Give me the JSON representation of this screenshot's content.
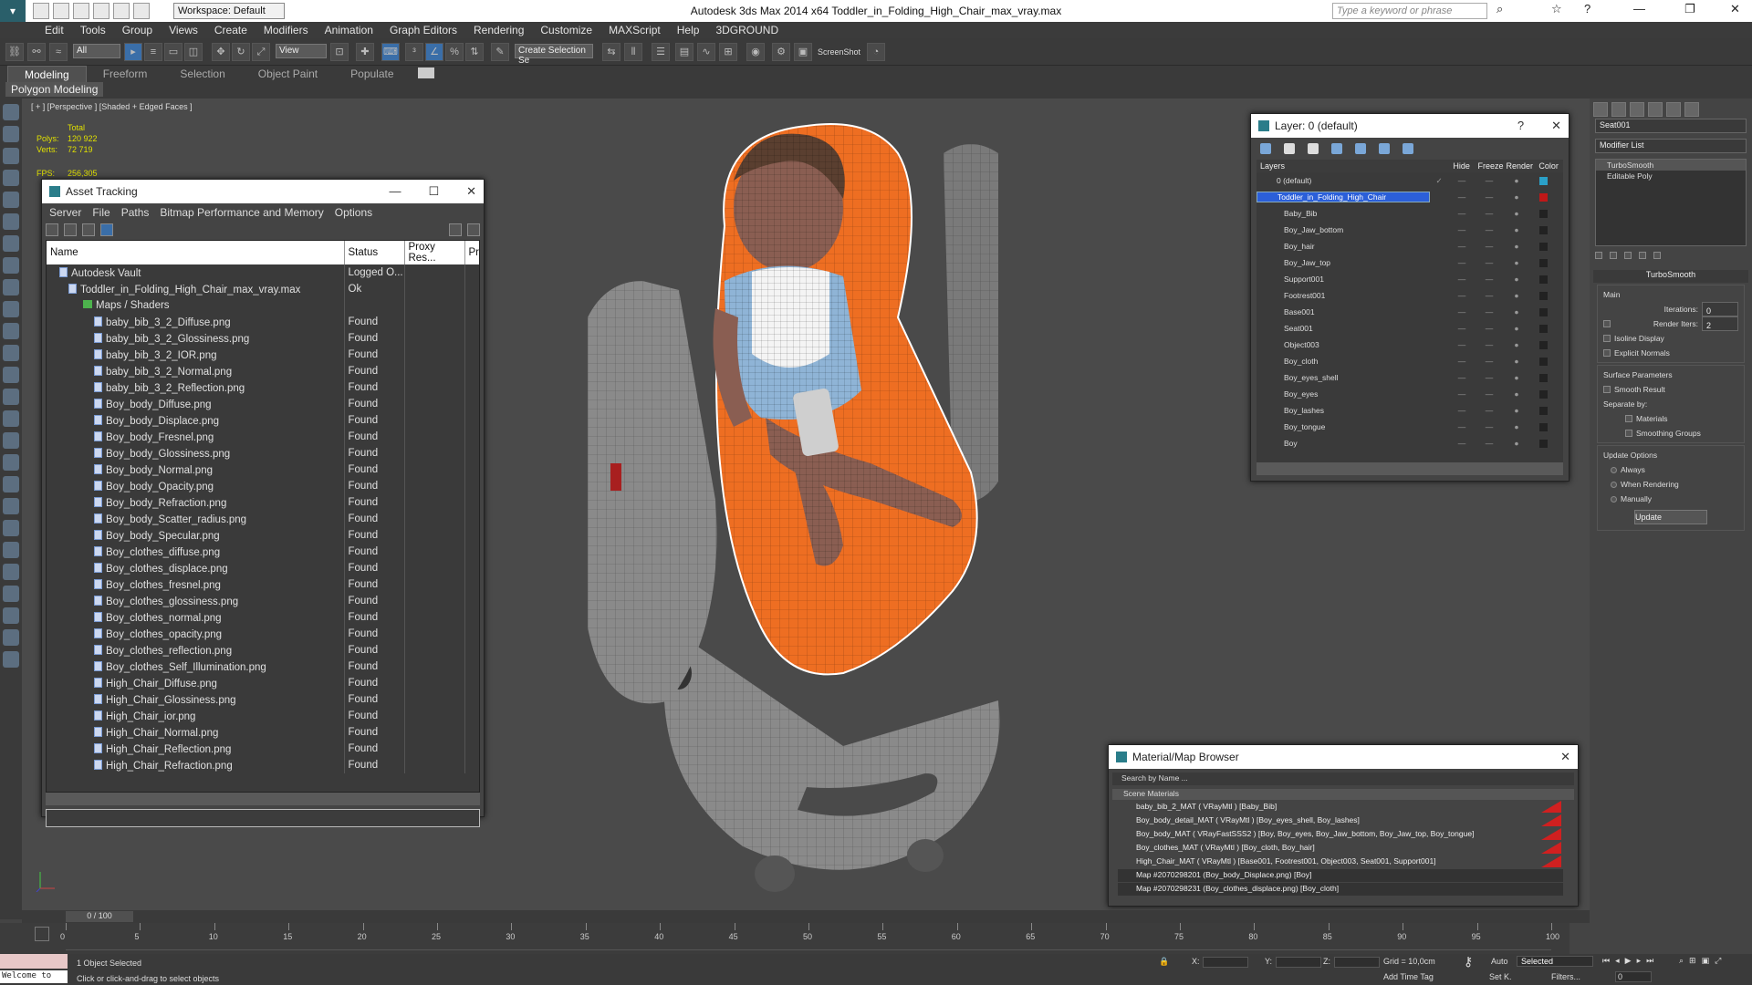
{
  "app": {
    "title": "Autodesk 3ds Max  2014 x64     Toddler_in_Folding_High_Chair_max_vray.max",
    "workspace": "Workspace: Default",
    "search_placeholder": "Type a keyword or phrase"
  },
  "menu": [
    "Edit",
    "Tools",
    "Group",
    "Views",
    "Create",
    "Modifiers",
    "Animation",
    "Graph Editors",
    "Rendering",
    "Customize",
    "MAXScript",
    "Help",
    "3DGROUND"
  ],
  "toolbar": {
    "filter": "All",
    "refcoord": "View",
    "selset": "Create Selection Se",
    "screenshot": "ScreenShot"
  },
  "ribbon": {
    "tabs": [
      "Modeling",
      "Freeform",
      "Selection",
      "Object Paint",
      "Populate"
    ],
    "active": "Modeling",
    "sub": "Polygon Modeling"
  },
  "viewport": {
    "label": "[ + ] [Perspective ] [Shaded + Edged Faces ]",
    "stats": {
      "total": "Total",
      "polys_label": "Polys:",
      "polys": "120 922",
      "verts_label": "Verts:",
      "verts": "72 719",
      "fps_label": "FPS:",
      "fps": "256,305"
    }
  },
  "asset_tracking": {
    "title": "Asset Tracking",
    "menu": [
      "Server",
      "File",
      "Paths",
      "Bitmap Performance and Memory",
      "Options"
    ],
    "columns": [
      "Name",
      "Status",
      "Proxy Res...",
      "Prox"
    ],
    "rows": [
      {
        "name": "Autodesk Vault",
        "status": "Logged O...",
        "type": "vault"
      },
      {
        "name": "Toddler_in_Folding_High_Chair_max_vray.max",
        "status": "Ok",
        "type": "max"
      },
      {
        "name": "Maps / Shaders",
        "status": "",
        "type": "folder"
      },
      {
        "name": "baby_bib_3_2_Diffuse.png",
        "status": "Found",
        "type": "file"
      },
      {
        "name": "baby_bib_3_2_Glossiness.png",
        "status": "Found",
        "type": "file"
      },
      {
        "name": "baby_bib_3_2_IOR.png",
        "status": "Found",
        "type": "file"
      },
      {
        "name": "baby_bib_3_2_Normal.png",
        "status": "Found",
        "type": "file"
      },
      {
        "name": "baby_bib_3_2_Reflection.png",
        "status": "Found",
        "type": "file"
      },
      {
        "name": "Boy_body_Diffuse.png",
        "status": "Found",
        "type": "file"
      },
      {
        "name": "Boy_body_Displace.png",
        "status": "Found",
        "type": "file"
      },
      {
        "name": "Boy_body_Fresnel.png",
        "status": "Found",
        "type": "file"
      },
      {
        "name": "Boy_body_Glossiness.png",
        "status": "Found",
        "type": "file"
      },
      {
        "name": "Boy_body_Normal.png",
        "status": "Found",
        "type": "file"
      },
      {
        "name": "Boy_body_Opacity.png",
        "status": "Found",
        "type": "file"
      },
      {
        "name": "Boy_body_Refraction.png",
        "status": "Found",
        "type": "file"
      },
      {
        "name": "Boy_body_Scatter_radius.png",
        "status": "Found",
        "type": "file"
      },
      {
        "name": "Boy_body_Specular.png",
        "status": "Found",
        "type": "file"
      },
      {
        "name": "Boy_clothes_diffuse.png",
        "status": "Found",
        "type": "file"
      },
      {
        "name": "Boy_clothes_displace.png",
        "status": "Found",
        "type": "file"
      },
      {
        "name": "Boy_clothes_fresnel.png",
        "status": "Found",
        "type": "file"
      },
      {
        "name": "Boy_clothes_glossiness.png",
        "status": "Found",
        "type": "file"
      },
      {
        "name": "Boy_clothes_normal.png",
        "status": "Found",
        "type": "file"
      },
      {
        "name": "Boy_clothes_opacity.png",
        "status": "Found",
        "type": "file"
      },
      {
        "name": "Boy_clothes_reflection.png",
        "status": "Found",
        "type": "file"
      },
      {
        "name": "Boy_clothes_Self_Illumination.png",
        "status": "Found",
        "type": "file"
      },
      {
        "name": "High_Chair_Diffuse.png",
        "status": "Found",
        "type": "file"
      },
      {
        "name": "High_Chair_Glossiness.png",
        "status": "Found",
        "type": "file"
      },
      {
        "name": "High_Chair_ior.png",
        "status": "Found",
        "type": "file"
      },
      {
        "name": "High_Chair_Normal.png",
        "status": "Found",
        "type": "file"
      },
      {
        "name": "High_Chair_Reflection.png",
        "status": "Found",
        "type": "file"
      },
      {
        "name": "High_Chair_Refraction.png",
        "status": "Found",
        "type": "file"
      }
    ]
  },
  "layers": {
    "title": "Layer: 0 (default)",
    "columns": [
      "Layers",
      "Hide",
      "Freeze",
      "Render",
      "Color"
    ],
    "items": [
      {
        "name": "0 (default)",
        "level": 0,
        "color": "#2aa0c8"
      },
      {
        "name": "Toddler_in_Folding_High_Chair",
        "level": 0,
        "selected": true,
        "color": "#c01818"
      },
      {
        "name": "Baby_Bib",
        "level": 1
      },
      {
        "name": "Boy_Jaw_bottom",
        "level": 1
      },
      {
        "name": "Boy_hair",
        "level": 1
      },
      {
        "name": "Boy_Jaw_top",
        "level": 1
      },
      {
        "name": "Support001",
        "level": 1
      },
      {
        "name": "Footrest001",
        "level": 1
      },
      {
        "name": "Base001",
        "level": 1
      },
      {
        "name": "Seat001",
        "level": 1
      },
      {
        "name": "Object003",
        "level": 1
      },
      {
        "name": "Boy_cloth",
        "level": 1
      },
      {
        "name": "Boy_eyes_shell",
        "level": 1
      },
      {
        "name": "Boy_eyes",
        "level": 1
      },
      {
        "name": "Boy_lashes",
        "level": 1
      },
      {
        "name": "Boy_tongue",
        "level": 1
      },
      {
        "name": "Boy",
        "level": 1
      }
    ]
  },
  "material_browser": {
    "title": "Material/Map Browser",
    "search": "Search by Name ...",
    "section": "Scene Materials",
    "items": [
      {
        "text": "baby_bib_2_MAT  ( VRayMtl ) [Baby_Bib]",
        "kind": "mat"
      },
      {
        "text": "Boy_body_detail_MAT  ( VRayMtl ) [Boy_eyes_shell, Boy_lashes]",
        "kind": "mat"
      },
      {
        "text": "Boy_body_MAT  ( VRayFastSSS2 ) [Boy, Boy_eyes, Boy_Jaw_bottom, Boy_Jaw_top, Boy_tongue]",
        "kind": "mat"
      },
      {
        "text": "Boy_clothes_MAT  ( VRayMtl ) [Boy_cloth, Boy_hair]",
        "kind": "mat"
      },
      {
        "text": "High_Chair_MAT  ( VRayMtl ) [Base001, Footrest001, Object003, Seat001, Support001]",
        "kind": "mat"
      },
      {
        "text": "Map #2070298201 (Boy_body_Displace.png) [Boy]",
        "kind": "map"
      },
      {
        "text": "Map #2070298231 (Boy_clothes_displace.png) [Boy_cloth]",
        "kind": "map"
      }
    ]
  },
  "command_panel": {
    "object_name": "Seat001",
    "modifier_list": "Modifier List",
    "stack": [
      "TurboSmooth",
      "Editable Poly"
    ],
    "rollout": "TurboSmooth",
    "main": "Main",
    "iterations_label": "Iterations:",
    "iterations": "0",
    "render_iters_label": "Render Iters:",
    "render_iters": "2",
    "isoline": "Isoline Display",
    "explicit": "Explicit Normals",
    "surface": "Surface Parameters",
    "smooth_result": "Smooth Result",
    "separate": "Separate by:",
    "materials": "Materials",
    "smoothing_groups": "Smoothing Groups",
    "update_options": "Update Options",
    "always": "Always",
    "when_rendering": "When Rendering",
    "manually": "Manually",
    "update_btn": "Update"
  },
  "timeline": {
    "frame": "0 / 100",
    "ticks": [
      "0",
      "5",
      "10",
      "15",
      "20",
      "25",
      "30",
      "35",
      "40",
      "45",
      "50",
      "55",
      "60",
      "65",
      "70",
      "75",
      "80",
      "85",
      "90",
      "95",
      "100"
    ]
  },
  "status": {
    "maxscript": "Welcome to",
    "selected": "1 Object Selected",
    "prompt": "Click or click-and-drag to select objects",
    "x": "X:",
    "y": "Y:",
    "z": "Z:",
    "grid": "Grid = 10,0cm",
    "add_time_tag": "Add Time Tag",
    "auto": "Auto",
    "selected_dd": "Selected",
    "setk": "Set K.",
    "filters": "Filters...",
    "frame": "0"
  }
}
